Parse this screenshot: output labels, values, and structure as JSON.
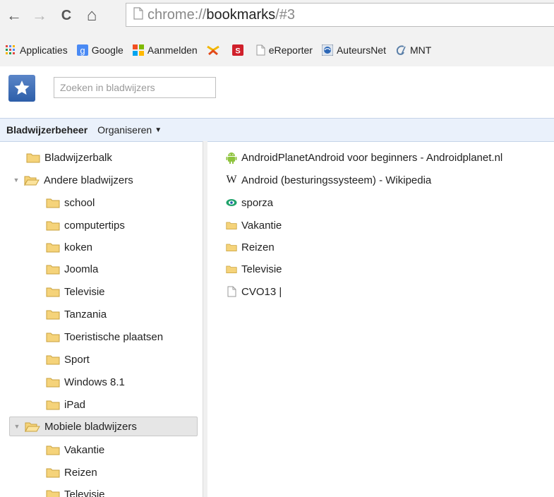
{
  "toolbar": {
    "back": "←",
    "forward": "→",
    "reload": "C",
    "home": "⌂",
    "url_scheme": "chrome://",
    "url_host": "bookmarks",
    "url_rest": "/#3"
  },
  "bookmarks_bar": {
    "items": [
      {
        "label": "Applicaties",
        "icon": "apps-grid-icon"
      },
      {
        "label": "Google",
        "icon": "google-icon"
      },
      {
        "label": "Aanmelden",
        "icon": "windows-icon"
      },
      {
        "label": "",
        "icon": "yellow-logo-icon"
      },
      {
        "label": "",
        "icon": "s-logo-icon"
      },
      {
        "label": "eReporter",
        "icon": "page-icon"
      },
      {
        "label": "AuteursNet",
        "icon": "globe-icon"
      },
      {
        "label": "MNT",
        "icon": "mnt-icon"
      }
    ]
  },
  "search": {
    "placeholder": "Zoeken in bladwijzers"
  },
  "manager": {
    "title": "Bladwijzerbeheer",
    "organize": "Organiseren"
  },
  "tree": {
    "items": [
      {
        "label": "Bladwijzerbalk",
        "level": 1,
        "expander": ""
      },
      {
        "label": "Andere bladwijzers",
        "level": 0,
        "expander": "▼"
      },
      {
        "label": "school",
        "level": 2
      },
      {
        "label": "computertips",
        "level": 2
      },
      {
        "label": "koken",
        "level": 2
      },
      {
        "label": "Joomla",
        "level": 2
      },
      {
        "label": "Televisie",
        "level": 2
      },
      {
        "label": "Tanzania",
        "level": 2
      },
      {
        "label": "Toeristische plaatsen",
        "level": 2
      },
      {
        "label": "Sport",
        "level": 2
      },
      {
        "label": "Windows 8.1",
        "level": 2
      },
      {
        "label": "iPad",
        "level": 2
      },
      {
        "label": "Mobiele bladwijzers",
        "level": 0,
        "expander": "▼",
        "selected": true
      },
      {
        "label": "Vakantie",
        "level": 2
      },
      {
        "label": "Reizen",
        "level": 2
      },
      {
        "label": "Televisie",
        "level": 2
      }
    ]
  },
  "list": {
    "items": [
      {
        "label": "AndroidPlanetAndroid voor beginners - Androidplanet.nl",
        "icon": "android-icon"
      },
      {
        "label": "Android (besturingssysteem) - Wikipedia",
        "icon": "wikipedia-icon"
      },
      {
        "label": "sporza",
        "icon": "sporza-icon"
      },
      {
        "label": "Vakantie",
        "icon": "folder-icon"
      },
      {
        "label": "Reizen",
        "icon": "folder-icon"
      },
      {
        "label": "Televisie",
        "icon": "folder-icon"
      },
      {
        "label": "CVO13 |",
        "icon": "page-icon"
      }
    ]
  },
  "colors": {
    "folder_fill": "#f5d37a",
    "folder_stroke": "#c9a23d",
    "header_bg": "#eaf1fb",
    "android_green": "#8ec33d"
  }
}
